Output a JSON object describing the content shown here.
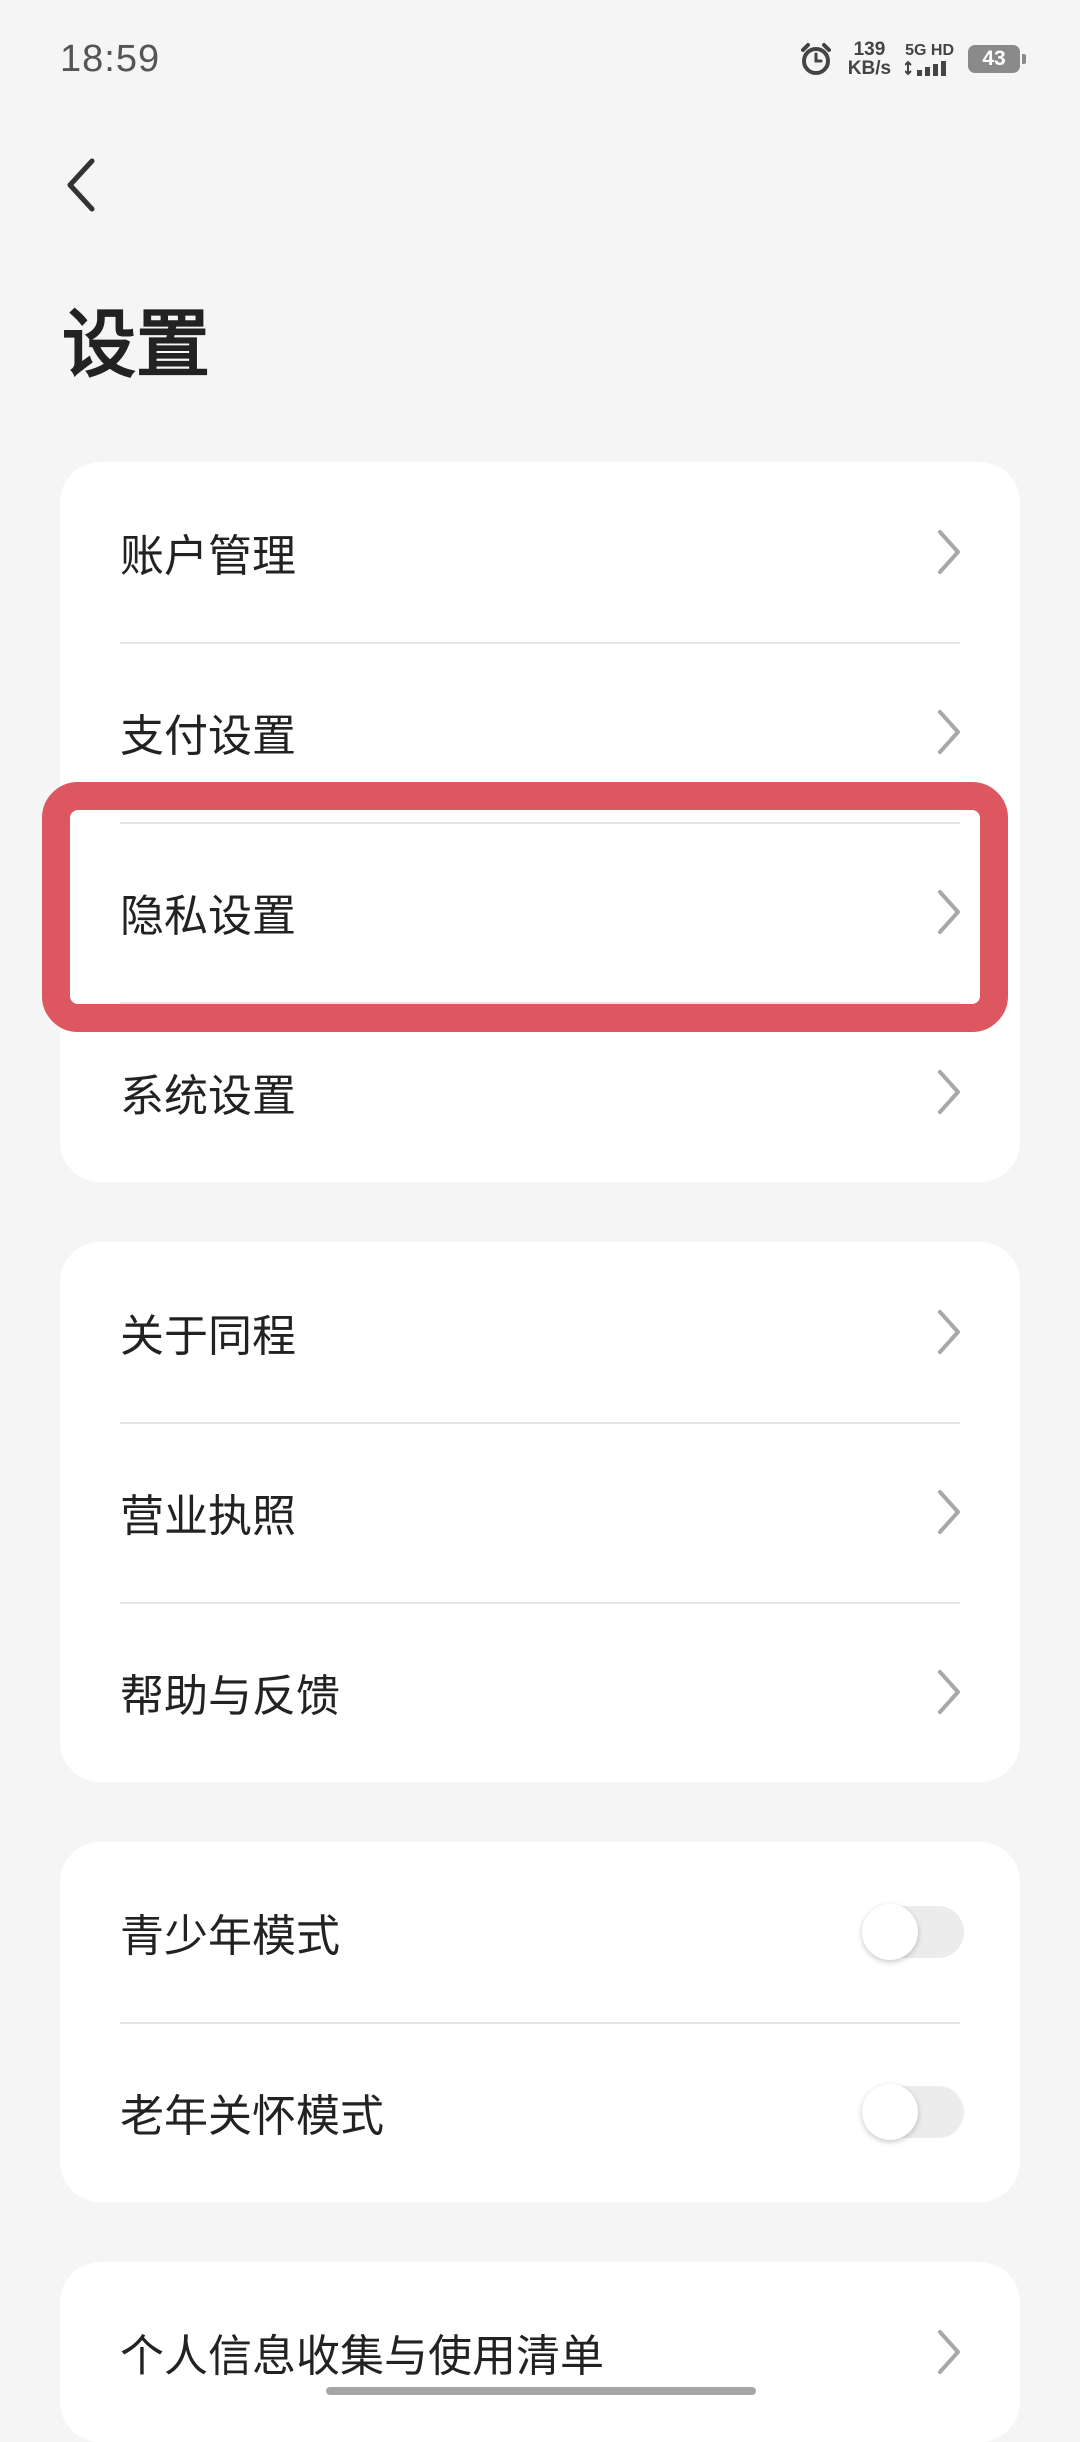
{
  "status_bar": {
    "time": "18:59",
    "speed_value": "139",
    "speed_unit": "KB/s",
    "network": "5G HD",
    "battery": "43"
  },
  "header": {
    "title": "设置"
  },
  "groups": [
    {
      "items": [
        {
          "label": "账户管理"
        },
        {
          "label": "支付设置"
        },
        {
          "label": "隐私设置"
        },
        {
          "label": "系统设置"
        }
      ]
    },
    {
      "items": [
        {
          "label": "关于同程"
        },
        {
          "label": "营业执照"
        },
        {
          "label": "帮助与反馈"
        }
      ]
    },
    {
      "items": [
        {
          "label": "青少年模式",
          "toggle_on": false
        },
        {
          "label": "老年关怀模式",
          "toggle_on": false
        }
      ]
    },
    {
      "items": [
        {
          "label": "个人信息收集与使用清单"
        }
      ]
    }
  ],
  "colors": {
    "highlight": "#dc5760",
    "background": "#f5f5f5",
    "card": "#ffffff"
  },
  "icons": {
    "back": "chevron-left-icon",
    "row_arrow": "chevron-right-icon",
    "alarm": "alarm-clock-icon"
  }
}
